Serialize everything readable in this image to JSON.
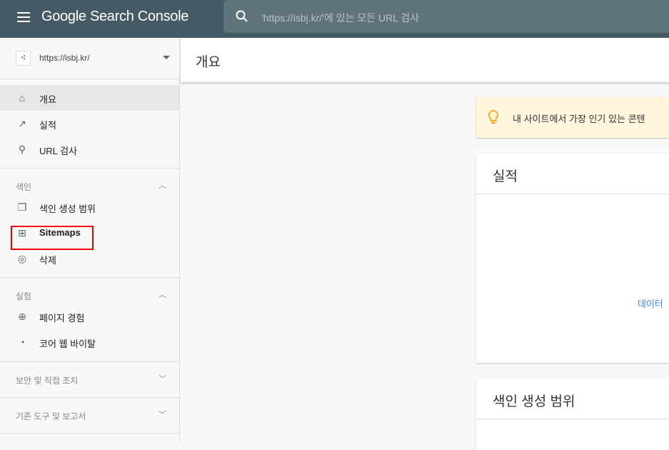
{
  "header": {
    "app_title": "Google Search Console",
    "search_placeholder": "'https://isbj.kr/'에 있는 모든 URL 검사"
  },
  "sidebar": {
    "property": "https://isbj.kr/",
    "items": [
      {
        "label": "개요",
        "icon": "home-icon"
      },
      {
        "label": "실적",
        "icon": "trending-up-icon"
      },
      {
        "label": "URL 검사",
        "icon": "search-icon"
      }
    ],
    "sections": [
      {
        "title": "색인",
        "expanded": true,
        "items": [
          {
            "label": "색인 생성 범위",
            "icon": "pages-icon"
          },
          {
            "label": "Sitemaps",
            "icon": "sitemap-icon",
            "highlighted": true
          },
          {
            "label": "삭제",
            "icon": "eye-off-icon"
          }
        ]
      },
      {
        "title": "실험",
        "expanded": true,
        "items": [
          {
            "label": "페이지 경험",
            "icon": "plus-circle-icon"
          },
          {
            "label": "코어 웹 바이탈",
            "icon": "speedometer-icon"
          }
        ]
      },
      {
        "title": "보안 및 직접 조치",
        "expanded": false
      },
      {
        "title": "기존 도구 및 보고서",
        "expanded": false
      }
    ]
  },
  "main": {
    "page_title": "개요",
    "tip": "내 사이트에서 가장 인기 있는 콘텐",
    "cards": [
      {
        "title": "실적",
        "link": "데이터"
      },
      {
        "title": "색인 생성 범위"
      }
    ]
  },
  "colors": {
    "topbar": "#455a64",
    "highlight": "#ee0000",
    "tip_bg": "#fdf6dc"
  }
}
